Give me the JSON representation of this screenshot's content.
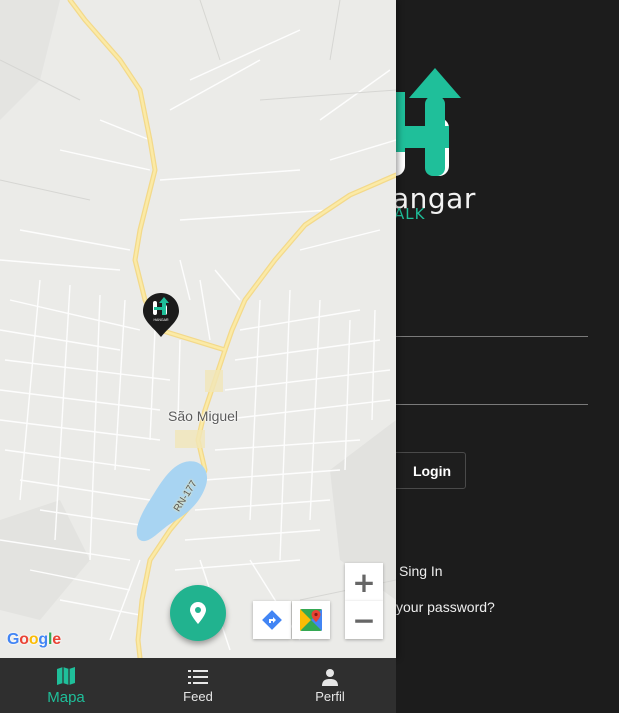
{
  "login": {
    "logo_text": "angar",
    "logo_sub": "ALK",
    "login_button": "Login",
    "sign_in_link": "Sing In",
    "forgot_password_link": "your password?"
  },
  "map": {
    "city_label": "São Miguel",
    "road_label": "RN-177",
    "zoom_in": "+",
    "zoom_out": "−",
    "google_logo": [
      "G",
      "o",
      "o",
      "g",
      "l",
      "e"
    ],
    "google_colors": [
      "#4285F4",
      "#EA4335",
      "#FBBC05",
      "#4285F4",
      "#34A853",
      "#EA4335"
    ],
    "pin_logo_text": "HANGAR"
  },
  "nav": {
    "items": [
      {
        "label": "Mapa",
        "icon": "map-icon",
        "active": true
      },
      {
        "label": "Feed",
        "icon": "list-icon",
        "active": false
      },
      {
        "label": "Perfil",
        "icon": "person-icon",
        "active": false
      }
    ]
  },
  "colors": {
    "accent": "#1fbf9a",
    "fab": "#21b38f",
    "background_dark": "#1c1c1c",
    "nav_bar": "#2f2f2f",
    "major_road": "#f7e08f",
    "water": "#a8d4f2"
  }
}
